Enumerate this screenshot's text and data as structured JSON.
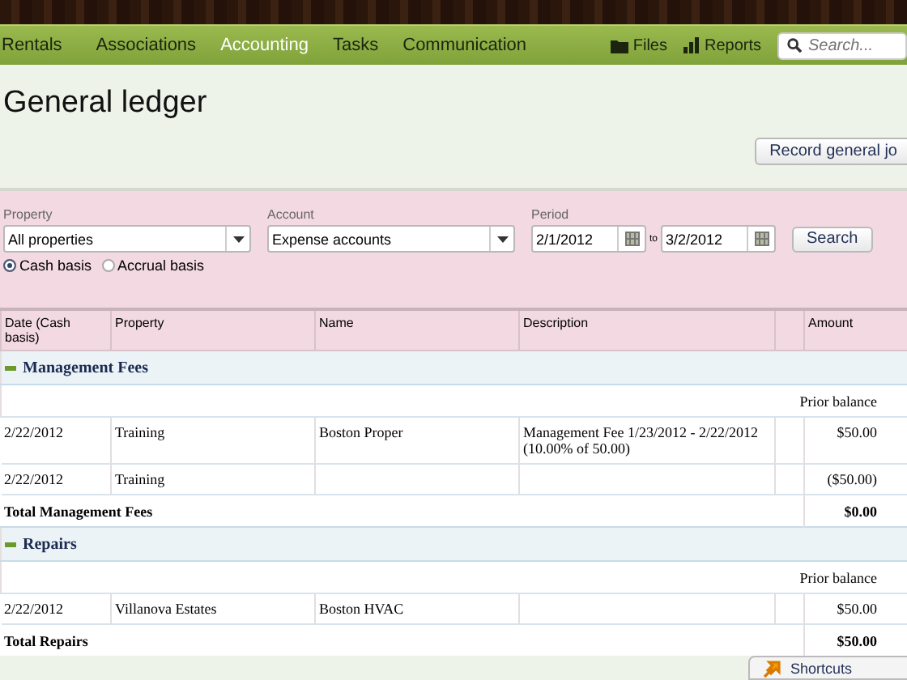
{
  "nav": {
    "tabs": [
      {
        "label": "Rentals",
        "selected": false
      },
      {
        "label": "Associations",
        "selected": false
      },
      {
        "label": "Accounting",
        "selected": true
      },
      {
        "label": "Tasks",
        "selected": false
      },
      {
        "label": "Communication",
        "selected": false
      }
    ],
    "links": [
      {
        "label": "Files",
        "kind": "folder"
      },
      {
        "label": "Reports",
        "kind": "bars"
      }
    ],
    "search": {
      "placeholder": "Search..."
    }
  },
  "page": {
    "title": "General ledger",
    "action": "Record general jo"
  },
  "filters": {
    "property": {
      "label": "Property",
      "value": "All properties"
    },
    "account": {
      "label": "Account",
      "value": "Expense accounts"
    },
    "period": {
      "label": "Period",
      "from": "2/1/2012",
      "separator": "to",
      "to": "3/2/2012"
    },
    "search_button": "Search",
    "basis": [
      {
        "label": "Cash basis",
        "selected": true
      },
      {
        "label": "Accrual basis",
        "selected": false
      }
    ]
  },
  "table": {
    "columns": [
      "Date (Cash basis)",
      "Property",
      "Name",
      "Description",
      "",
      "Amount"
    ],
    "groups": [
      {
        "title": "Management Fees",
        "expanded": true,
        "prior_balance": "Prior balance",
        "rows": [
          {
            "date": "2/22/2012",
            "property": "Training",
            "name": "Boston Proper",
            "description": "Management Fee 1/23/2012 - 2/22/2012 (10.00% of 50.00)",
            "amount": "$50.00"
          },
          {
            "date": "2/22/2012",
            "property": "Training",
            "name": "",
            "description": "",
            "amount": "($50.00)"
          }
        ],
        "total_label": "Total Management Fees",
        "total_amount": "$0.00"
      },
      {
        "title": "Repairs",
        "expanded": true,
        "prior_balance": "Prior balance",
        "rows": [
          {
            "date": "2/22/2012",
            "property": "Villanova Estates",
            "name": "Boston HVAC",
            "description": "",
            "amount": "$50.00"
          }
        ],
        "total_label": "Total Repairs",
        "total_amount": "$50.00"
      }
    ]
  },
  "shortcuts": {
    "label": "Shortcuts"
  }
}
